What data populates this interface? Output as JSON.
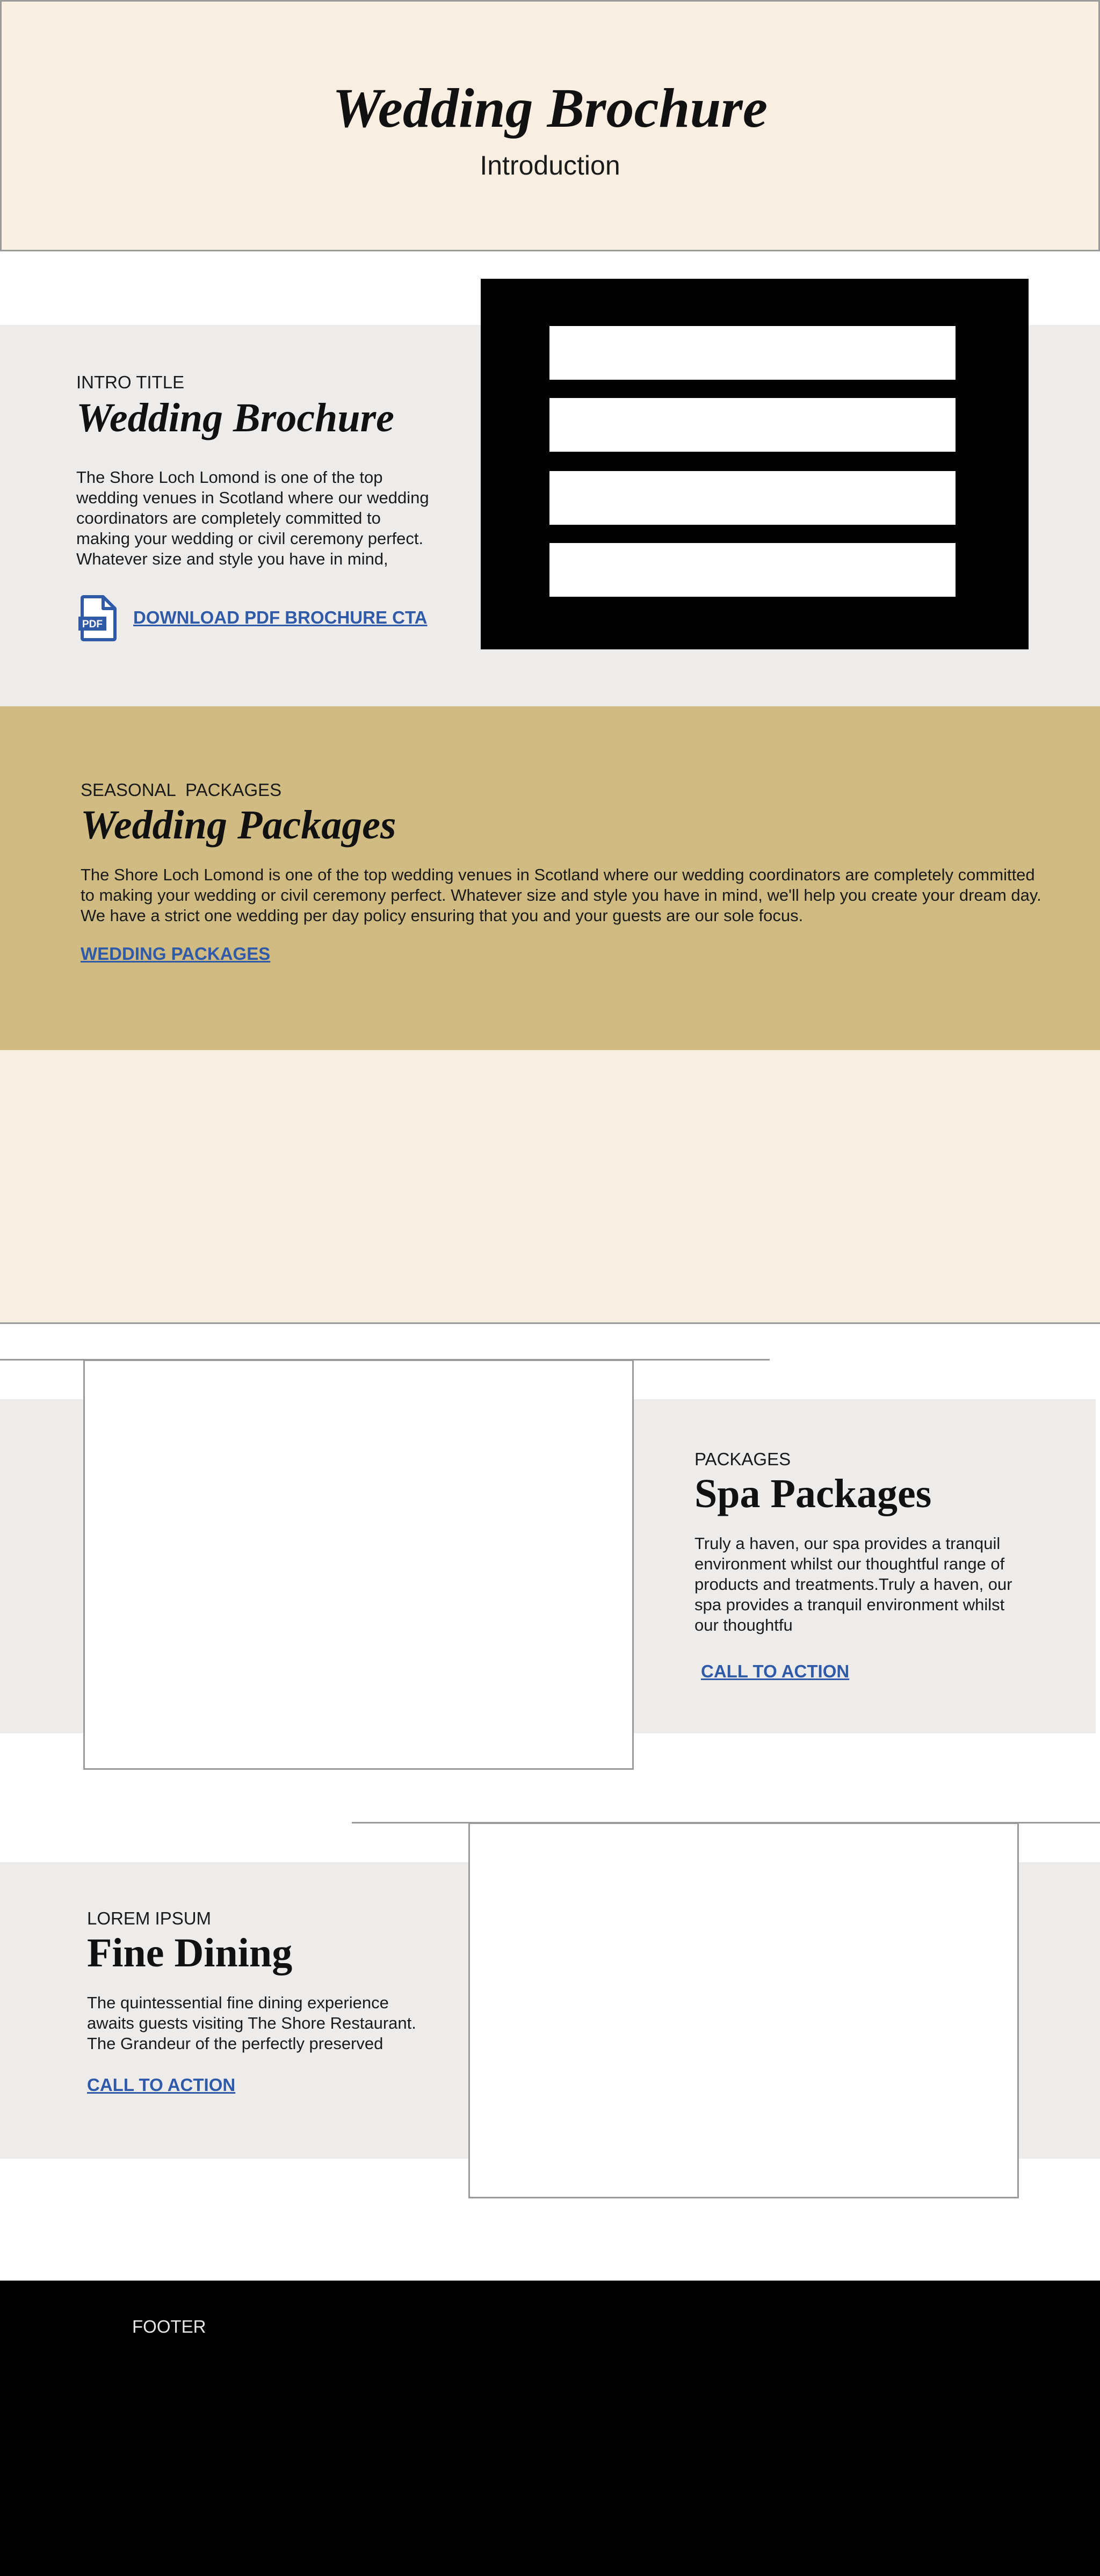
{
  "hero": {
    "title": "Wedding Brochure",
    "subtitle": "Introduction",
    "background": "#f8eee1"
  },
  "intro": {
    "eyebrow": "INTRO TITLE",
    "title": "Wedding Brochure",
    "body": "The Shore Loch Lomond is one of the top wedding venues in Scotland where our wedding coordinators are completely committed to making your wedding or civil ceremony perfect. Whatever size and style you have in mind,",
    "pdf_icon": "pdf-file-icon",
    "pdf_icon_text": "PDF",
    "cta": "DOWNLOAD PDF BROCHURE CTA",
    "background": "#eeecea"
  },
  "wedding": {
    "eyebrow": "SEASONAL  PACKAGES",
    "title": "Wedding Packages",
    "body": "The Shore Loch Lomond is one of the top wedding venues in Scotland where our wedding coordinators are completely committed to making your wedding or civil ceremony perfect. Whatever size and style you have in mind, we'll help you create your dream day. We have a strict one wedding per day policy ensuring that you and your guests are our sole focus.",
    "cta": "WEDDING PACKAGES",
    "background": "#d0bb83"
  },
  "spa": {
    "eyebrow": "PACKAGES",
    "title": "Spa Packages",
    "body": "Truly a haven, our spa provides a tranquil environment whilst our thoughtful range of products and treatments.Truly a haven, our spa provides a tranquil environment whilst our thoughtfu",
    "cta": "CALL TO ACTION"
  },
  "dining": {
    "eyebrow": "LOREM IPSUM",
    "title": "Fine Dining",
    "body": "The quintessential fine dining experience awaits guests visiting The Shore Restaurant. The Grandeur of the perfectly preserved",
    "cta": "CALL TO ACTION"
  },
  "footer": {
    "label": "FOOTER"
  },
  "colors": {
    "link": "#2f5aa8",
    "cream": "#f8eee1",
    "grey_band": "#eeecea",
    "gold_band": "#d0bb83",
    "footer": "#000000"
  }
}
